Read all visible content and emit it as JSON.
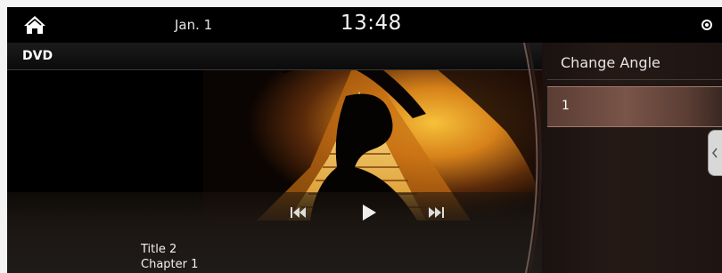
{
  "status_bar": {
    "date": "Jan. 1",
    "time": "13:48",
    "home_icon": "home-icon"
  },
  "player": {
    "source": "DVD",
    "title": "Title 2",
    "chapter": "Chapter 1",
    "controls": [
      "skip-previous-icon",
      "play-icon",
      "skip-next-icon"
    ]
  },
  "angle_panel": {
    "heading": "Change Angle",
    "options": [
      "1"
    ],
    "selected": "1"
  },
  "colors": {
    "accent": "#f0a020",
    "panel_bg": "#241915",
    "highlight": "#7a5448"
  }
}
